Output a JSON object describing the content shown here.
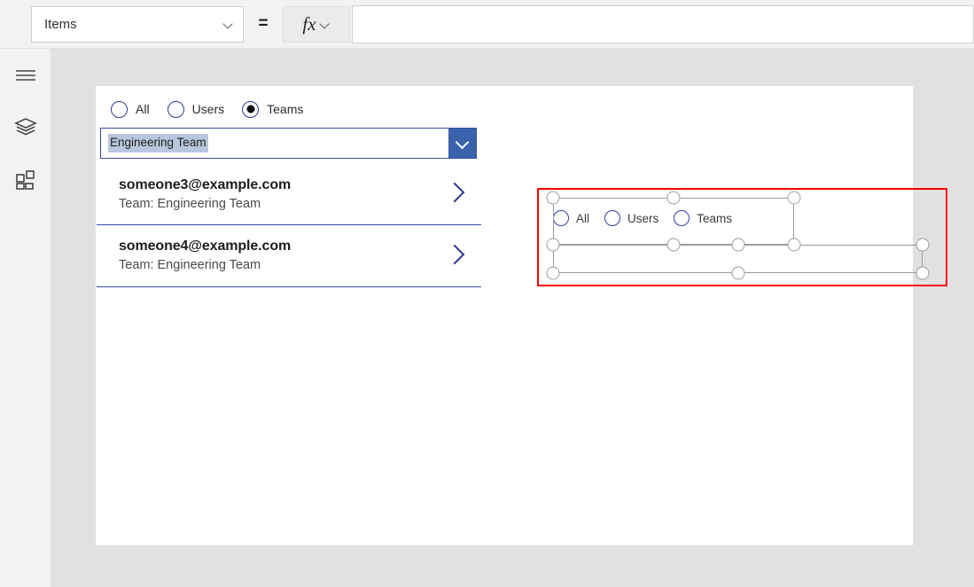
{
  "formula_bar": {
    "property_label": "Items",
    "property_chevron_icon": "chevron-down-icon",
    "equals_label": "=",
    "fx_label": "fx",
    "fx_chevron_icon": "chevron-down-icon",
    "formula_value": "",
    "formula_placeholder": ""
  },
  "left_rail": {
    "items": [
      {
        "name": "menu",
        "icon": "hamburger-menu-icon"
      },
      {
        "name": "tree-view",
        "icon": "layers-icon"
      },
      {
        "name": "insert",
        "icon": "grid-add-icon"
      }
    ]
  },
  "canvas": {
    "filter_radio_group": {
      "name": "filter-radio-group",
      "selected": "Teams",
      "options": [
        {
          "label": "All",
          "checked": false
        },
        {
          "label": "Users",
          "checked": false
        },
        {
          "label": "Teams",
          "checked": true
        }
      ]
    },
    "team_dropdown": {
      "name": "team-dropdown",
      "value": "Engineering Team",
      "placeholder": "",
      "chevron_icon": "chevron-down-icon",
      "accent_color": "#3b63ab",
      "border_color": "#3b4da8",
      "value_highlight_color": "#b8c6de"
    },
    "gallery": {
      "name": "member-gallery",
      "separator_color": "#3b4da8",
      "chevron_icon": "chevron-right-icon",
      "rows": [
        {
          "title": "someone3@example.com",
          "subtitle": "Team: Engineering Team"
        },
        {
          "title": "someone4@example.com",
          "subtitle": "Team: Engineering Team"
        }
      ]
    },
    "selected_control": {
      "name": "selected-radio-group",
      "selection_outline_color": "#fe0000",
      "handle_fill": "#ffffff",
      "handle_stroke": "#9b9b9b",
      "options": [
        {
          "label": "All",
          "checked": false
        },
        {
          "label": "Users",
          "checked": false
        },
        {
          "label": "Teams",
          "checked": false
        }
      ]
    }
  }
}
